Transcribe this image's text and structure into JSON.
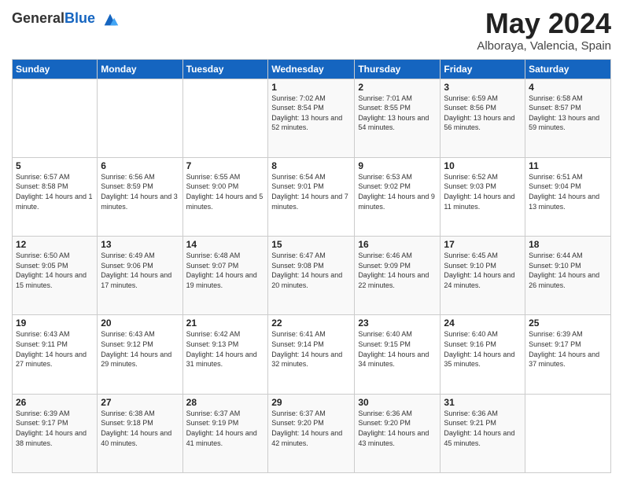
{
  "header": {
    "logo_general": "General",
    "logo_blue": "Blue",
    "month_title": "May 2024",
    "location": "Alboraya, Valencia, Spain"
  },
  "days_of_week": [
    "Sunday",
    "Monday",
    "Tuesday",
    "Wednesday",
    "Thursday",
    "Friday",
    "Saturday"
  ],
  "weeks": [
    [
      {
        "day": "",
        "info": ""
      },
      {
        "day": "",
        "info": ""
      },
      {
        "day": "",
        "info": ""
      },
      {
        "day": "1",
        "info": "Sunrise: 7:02 AM\nSunset: 8:54 PM\nDaylight: 13 hours and 52 minutes."
      },
      {
        "day": "2",
        "info": "Sunrise: 7:01 AM\nSunset: 8:55 PM\nDaylight: 13 hours and 54 minutes."
      },
      {
        "day": "3",
        "info": "Sunrise: 6:59 AM\nSunset: 8:56 PM\nDaylight: 13 hours and 56 minutes."
      },
      {
        "day": "4",
        "info": "Sunrise: 6:58 AM\nSunset: 8:57 PM\nDaylight: 13 hours and 59 minutes."
      }
    ],
    [
      {
        "day": "5",
        "info": "Sunrise: 6:57 AM\nSunset: 8:58 PM\nDaylight: 14 hours and 1 minute."
      },
      {
        "day": "6",
        "info": "Sunrise: 6:56 AM\nSunset: 8:59 PM\nDaylight: 14 hours and 3 minutes."
      },
      {
        "day": "7",
        "info": "Sunrise: 6:55 AM\nSunset: 9:00 PM\nDaylight: 14 hours and 5 minutes."
      },
      {
        "day": "8",
        "info": "Sunrise: 6:54 AM\nSunset: 9:01 PM\nDaylight: 14 hours and 7 minutes."
      },
      {
        "day": "9",
        "info": "Sunrise: 6:53 AM\nSunset: 9:02 PM\nDaylight: 14 hours and 9 minutes."
      },
      {
        "day": "10",
        "info": "Sunrise: 6:52 AM\nSunset: 9:03 PM\nDaylight: 14 hours and 11 minutes."
      },
      {
        "day": "11",
        "info": "Sunrise: 6:51 AM\nSunset: 9:04 PM\nDaylight: 14 hours and 13 minutes."
      }
    ],
    [
      {
        "day": "12",
        "info": "Sunrise: 6:50 AM\nSunset: 9:05 PM\nDaylight: 14 hours and 15 minutes."
      },
      {
        "day": "13",
        "info": "Sunrise: 6:49 AM\nSunset: 9:06 PM\nDaylight: 14 hours and 17 minutes."
      },
      {
        "day": "14",
        "info": "Sunrise: 6:48 AM\nSunset: 9:07 PM\nDaylight: 14 hours and 19 minutes."
      },
      {
        "day": "15",
        "info": "Sunrise: 6:47 AM\nSunset: 9:08 PM\nDaylight: 14 hours and 20 minutes."
      },
      {
        "day": "16",
        "info": "Sunrise: 6:46 AM\nSunset: 9:09 PM\nDaylight: 14 hours and 22 minutes."
      },
      {
        "day": "17",
        "info": "Sunrise: 6:45 AM\nSunset: 9:10 PM\nDaylight: 14 hours and 24 minutes."
      },
      {
        "day": "18",
        "info": "Sunrise: 6:44 AM\nSunset: 9:10 PM\nDaylight: 14 hours and 26 minutes."
      }
    ],
    [
      {
        "day": "19",
        "info": "Sunrise: 6:43 AM\nSunset: 9:11 PM\nDaylight: 14 hours and 27 minutes."
      },
      {
        "day": "20",
        "info": "Sunrise: 6:43 AM\nSunset: 9:12 PM\nDaylight: 14 hours and 29 minutes."
      },
      {
        "day": "21",
        "info": "Sunrise: 6:42 AM\nSunset: 9:13 PM\nDaylight: 14 hours and 31 minutes."
      },
      {
        "day": "22",
        "info": "Sunrise: 6:41 AM\nSunset: 9:14 PM\nDaylight: 14 hours and 32 minutes."
      },
      {
        "day": "23",
        "info": "Sunrise: 6:40 AM\nSunset: 9:15 PM\nDaylight: 14 hours and 34 minutes."
      },
      {
        "day": "24",
        "info": "Sunrise: 6:40 AM\nSunset: 9:16 PM\nDaylight: 14 hours and 35 minutes."
      },
      {
        "day": "25",
        "info": "Sunrise: 6:39 AM\nSunset: 9:17 PM\nDaylight: 14 hours and 37 minutes."
      }
    ],
    [
      {
        "day": "26",
        "info": "Sunrise: 6:39 AM\nSunset: 9:17 PM\nDaylight: 14 hours and 38 minutes."
      },
      {
        "day": "27",
        "info": "Sunrise: 6:38 AM\nSunset: 9:18 PM\nDaylight: 14 hours and 40 minutes."
      },
      {
        "day": "28",
        "info": "Sunrise: 6:37 AM\nSunset: 9:19 PM\nDaylight: 14 hours and 41 minutes."
      },
      {
        "day": "29",
        "info": "Sunrise: 6:37 AM\nSunset: 9:20 PM\nDaylight: 14 hours and 42 minutes."
      },
      {
        "day": "30",
        "info": "Sunrise: 6:36 AM\nSunset: 9:20 PM\nDaylight: 14 hours and 43 minutes."
      },
      {
        "day": "31",
        "info": "Sunrise: 6:36 AM\nSunset: 9:21 PM\nDaylight: 14 hours and 45 minutes."
      },
      {
        "day": "",
        "info": ""
      }
    ]
  ]
}
